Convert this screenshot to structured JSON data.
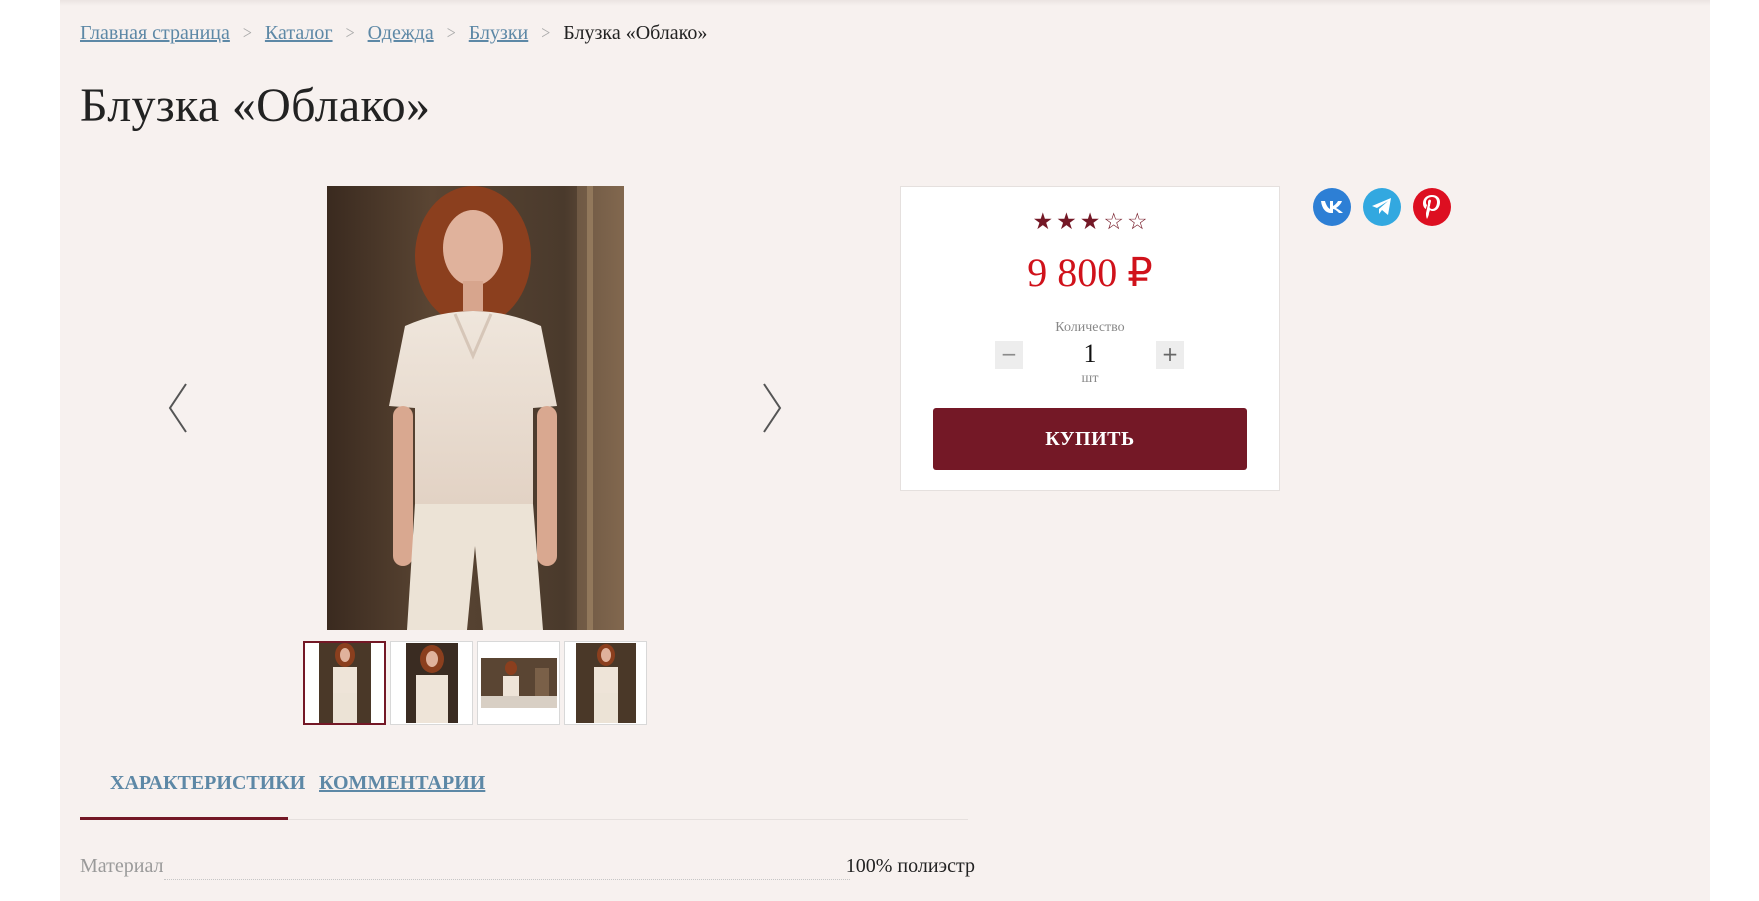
{
  "breadcrumbs": {
    "items": [
      "Главная страница",
      "Каталог",
      "Одежда",
      "Блузки"
    ],
    "current": "Блузка «Облако»"
  },
  "product": {
    "title": "Блузка «Облако»",
    "rating": 3,
    "rating_max": 5,
    "price": "9 800 ₽",
    "quantity_label": "Количество",
    "quantity": "1",
    "unit": "шт",
    "buy_label": "КУПИТЬ"
  },
  "gallery": {
    "thumbnail_count": 4,
    "active_thumbnail": 1
  },
  "socials": [
    "vk-icon",
    "telegram-icon",
    "pinterest-icon"
  ],
  "tabs": {
    "characteristics": "ХАРАКТЕРИСТИКИ",
    "comments": "КОММЕНТАРИИ",
    "active": "characteristics"
  },
  "specs": [
    {
      "label": "Материал",
      "value": "100% полиэстр"
    }
  ],
  "colors": {
    "accent": "#741826",
    "price": "#d0121b",
    "link": "#5d88a6",
    "background": "#f7f1ef"
  }
}
